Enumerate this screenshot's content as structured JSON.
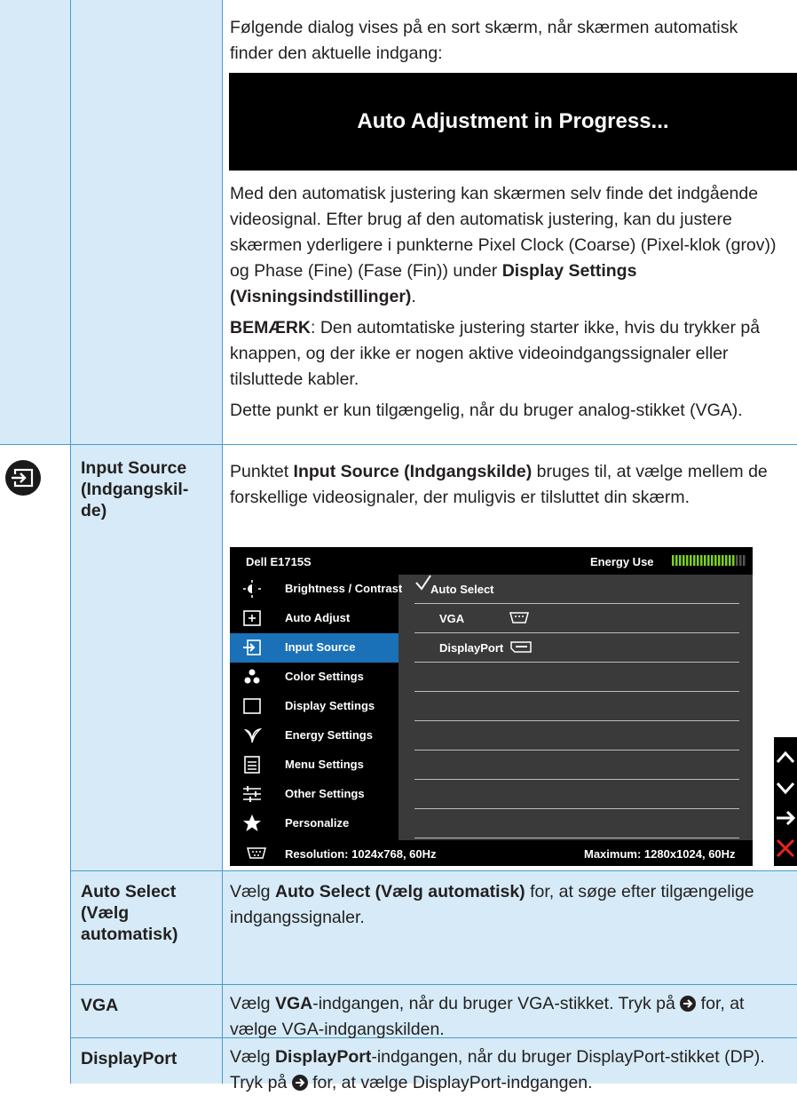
{
  "top_intro": "Følgende dialog vises på en sort skærm, når skærmen automatisk finder den aktuelle indgang:",
  "dialog_text": "Auto Adjustment in Progress...",
  "auto_adjust": {
    "p1_a": "Med den automatisk justering kan skærmen selv finde det indgående videosignal. Efter brug af den automatisk justering, kan du justere skærmen yderligere i punkterne Pixel Clock (Coarse) (Pixel-klok (grov)) og Phase (Fine) (Fase (Fin)) under ",
    "p1_b": "Display Settings (Visningsindstillinger)",
    "p1_c": ".",
    "note_label": "BEMÆRK",
    "note_text": ": Den automtatiske justering starter ikke, hvis du trykker på knappen, og der ikke er nogen aktive videoindgangssignaler eller tilsluttede kabler.",
    "p3": "Dette punkt er kun tilgængelig, når du bruger analog-stikket (VGA)."
  },
  "input_source": {
    "label_line1": "Input Source",
    "label_line2": "(Indgangskil-",
    "label_line3": "de)",
    "desc_a": "Punktet ",
    "desc_b": "Input Source (Indgangskilde)",
    "desc_c": " bruges til, at vælge mellem de forskellige videosignaler, der muligvis er tilsluttet din skærm."
  },
  "osd": {
    "model": "Dell E1715S",
    "energy_label": "Energy Use",
    "energy_level": 0.85,
    "menu_items": [
      {
        "label": "Brightness / Contrast",
        "icon": "brightness-icon"
      },
      {
        "label": "Auto Adjust",
        "icon": "auto-adjust-icon"
      },
      {
        "label": "Input Source",
        "icon": "input-source-icon"
      },
      {
        "label": "Color Settings",
        "icon": "color-settings-icon"
      },
      {
        "label": "Display Settings",
        "icon": "display-settings-icon"
      },
      {
        "label": "Energy Settings",
        "icon": "energy-settings-icon"
      },
      {
        "label": "Menu Settings",
        "icon": "menu-settings-icon"
      },
      {
        "label": "Other Settings",
        "icon": "other-settings-icon"
      },
      {
        "label": "Personalize",
        "icon": "star-icon"
      }
    ],
    "selected_menu": "Input Source",
    "sub_items": [
      "Auto Select",
      "VGA",
      "DisplayPort"
    ],
    "checked_sub": "Auto Select",
    "resolution": "Resolution: 1024x768, 60Hz",
    "maximum": "Maximum: 1280x1024, 60Hz",
    "colors": {
      "selected": "#1a71b8",
      "panel": "#3a3a3a",
      "energy": "#7fd21f"
    }
  },
  "auto_select": {
    "label_line1": "Auto Select",
    "label_line2": "(Vælg",
    "label_line3": "automatisk)",
    "desc_a": "Vælg ",
    "desc_b": "Auto Select (Vælg automatisk)",
    "desc_c": " for, at søge efter tilgængelige indgangssignaler."
  },
  "vga": {
    "label": "VGA",
    "desc_a": "Vælg ",
    "desc_b": "VGA",
    "desc_c": "-indgangen, når du bruger VGA-stikket. Tryk på ",
    "desc_d": " for, at vælge VGA-indgangskilden."
  },
  "displayport": {
    "label": "DisplayPort",
    "desc_a": "Vælg ",
    "desc_b": "DisplayPort",
    "desc_c": "-indgangen, når du bruger DisplayPort-stikket (DP). Tryk på ",
    "desc_d": " for, at vælge DisplayPort-indgangen."
  },
  "colors": {
    "row_bg": "#d6ebf7",
    "border": "#4a9ad0",
    "text": "#231f20"
  }
}
